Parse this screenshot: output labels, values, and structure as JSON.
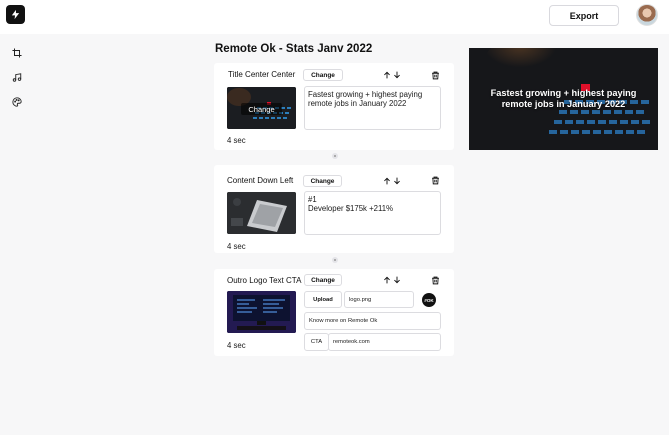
{
  "header": {
    "export_label": "Export"
  },
  "sidebar": {
    "items": [
      {
        "name": "crop-icon"
      },
      {
        "name": "music-note-icon"
      },
      {
        "name": "palette-icon"
      }
    ]
  },
  "main": {
    "title": "Remote Ok - Stats Janv 2022",
    "scenes": [
      {
        "name": "Title Center Center",
        "change_label": "Change",
        "thumb_change_label": "Change",
        "text": "Fastest growing + highest paying remote jobs in January 2022",
        "duration": "4 sec"
      },
      {
        "name": "Content Down Left",
        "change_label": "Change",
        "text_line1": "#1",
        "text_line2": "Developer $175k +211%",
        "duration": "4 sec"
      },
      {
        "name": "Outro Logo Text CTA",
        "change_label": "Change",
        "upload_label": "Upload",
        "logo_filename": "logo.png",
        "logo_badge": "#OK",
        "tagline": "Know more on Remote Ok",
        "cta_label": "CTA",
        "cta_value": "remoteok.com",
        "duration": "4 sec"
      }
    ]
  },
  "preview": {
    "text": "Fastest growing + highest paying remote jobs in January 2022",
    "accent_color": "#e0102a"
  },
  "colors": {
    "background": "#f7f7f8",
    "card": "#ffffff",
    "border": "#dcdce0",
    "text": "#1a1a1a"
  }
}
